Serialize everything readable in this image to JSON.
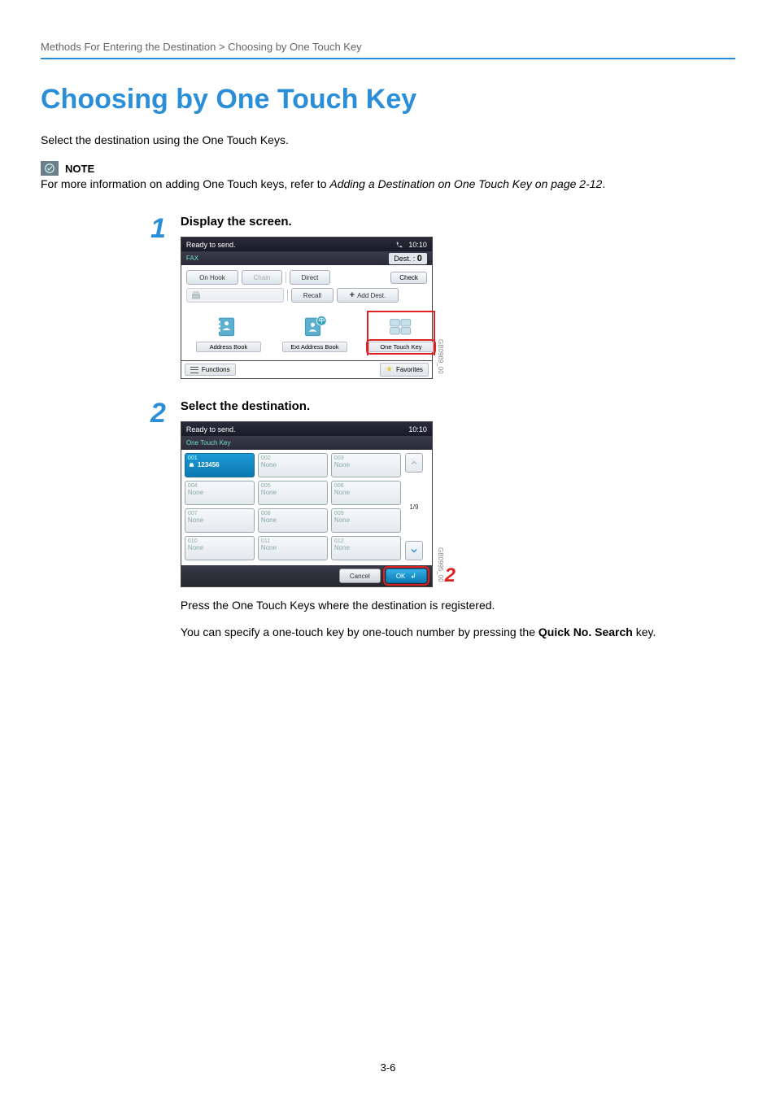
{
  "breadcrumb": "Methods For Entering the Destination > Choosing by One Touch Key",
  "heading": "Choosing by One Touch Key",
  "intro": "Select the destination using the One Touch Keys.",
  "note_label": "NOTE",
  "note_text_prefix": "For more information on adding One Touch keys, refer to ",
  "note_text_italic": "Adding a Destination on One Touch Key on page 2-12",
  "note_text_suffix": ".",
  "step1": {
    "num": "1",
    "title": "Display the screen.",
    "panel": {
      "status": "Ready to send.",
      "time": "10:10",
      "mode": "FAX",
      "dest_label": "Dest. :",
      "dest_count": "0",
      "check": "Check",
      "on_hook": "On Hook",
      "chain": "Chain",
      "direct": "Direct",
      "recall": "Recall",
      "add_dest": "Add Dest.",
      "address_book": "Address Book",
      "ext_address_book": "Ext Address Book",
      "one_touch": "One Touch Key",
      "functions": "Functions",
      "favorites": "Favorites",
      "screen_id": "GB0989_00"
    }
  },
  "step2": {
    "num": "2",
    "title": "Select the destination.",
    "panel": {
      "status": "Ready to send.",
      "time": "10:10",
      "mode": "One Touch Key",
      "keys": [
        {
          "num": "001",
          "name": "123456",
          "selected": true
        },
        {
          "num": "002",
          "name": "None",
          "selected": false
        },
        {
          "num": "003",
          "name": "None",
          "selected": false
        },
        {
          "num": "004",
          "name": "None",
          "selected": false
        },
        {
          "num": "005",
          "name": "None",
          "selected": false
        },
        {
          "num": "006",
          "name": "None",
          "selected": false
        },
        {
          "num": "007",
          "name": "None",
          "selected": false
        },
        {
          "num": "008",
          "name": "None",
          "selected": false
        },
        {
          "num": "009",
          "name": "None",
          "selected": false
        },
        {
          "num": "010",
          "name": "None",
          "selected": false
        },
        {
          "num": "011",
          "name": "None",
          "selected": false
        },
        {
          "num": "012",
          "name": "None",
          "selected": false
        }
      ],
      "page": "1/9",
      "cancel": "Cancel",
      "ok": "OK",
      "screen_id": "GB0995_00",
      "highlight_num": "2"
    },
    "body1": "Press the One Touch Keys where the destination is registered.",
    "body2_prefix": "You can specify a one-touch key by one-touch number by pressing the ",
    "body2_bold": "Quick No. Search",
    "body2_suffix": " key."
  },
  "footer_page": "3-6"
}
